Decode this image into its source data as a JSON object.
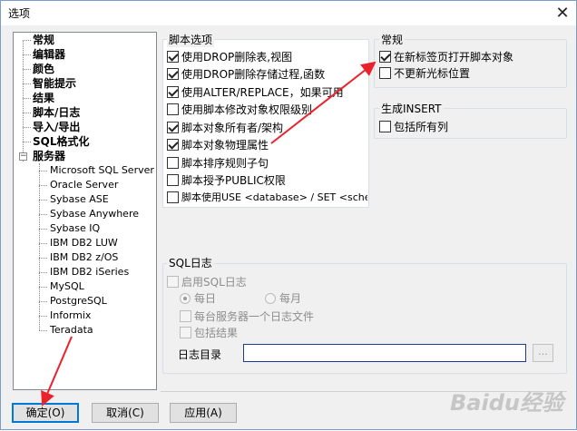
{
  "window": {
    "title": "选项",
    "close_glyph": "✕"
  },
  "tree": {
    "top_items": [
      "常规",
      "编辑器",
      "颜色",
      "智能提示",
      "结果",
      "脚本/日志",
      "导入/导出",
      "SQL格式化"
    ],
    "servers_label": "服务器",
    "servers_expander": "−",
    "server_items": [
      "Microsoft SQL Server",
      "Oracle Server",
      "Sybase ASE",
      "Sybase Anywhere",
      "Sybase IQ",
      "IBM DB2 LUW",
      "IBM DB2 z/OS",
      "IBM DB2 iSeries",
      "MySQL",
      "PostgreSQL",
      "Informix",
      "Teradata"
    ]
  },
  "script_options": {
    "title": "脚本选项",
    "items": [
      {
        "label": "使用DROP删除表,视图",
        "checked": true
      },
      {
        "label": "使用DROP删除存储过程,函数",
        "checked": true
      },
      {
        "label": "使用ALTER/REPLACE，如果可用",
        "checked": true
      },
      {
        "label": "使用脚本修改对象权限级别",
        "checked": false
      },
      {
        "label": "脚本对象所有者/架构",
        "checked": true
      },
      {
        "label": "脚本对象物理属性",
        "checked": true
      },
      {
        "label": "脚本排序规则子句",
        "checked": false
      },
      {
        "label": "脚本授予PUBLIC权限",
        "checked": false
      },
      {
        "label": "脚本使用USE <database> / SET <schem",
        "checked": false
      }
    ]
  },
  "general": {
    "title": "常规",
    "items": [
      {
        "label": "在新标签页打开脚本对象",
        "checked": true
      },
      {
        "label": "不更新光标位置",
        "checked": false
      }
    ]
  },
  "generate_insert": {
    "title": "生成INSERT",
    "items": [
      {
        "label": "包括所有列",
        "checked": false
      }
    ]
  },
  "sql_log": {
    "title": "SQL日志",
    "enable_label": "启用SQL日志",
    "daily_label": "每日",
    "monthly_label": "每月",
    "per_server_label": "每台服务器一个日志文件",
    "include_results_label": "包括结果",
    "log_dir_label": "日志目录",
    "log_dir_value": "",
    "browse_label": "..."
  },
  "buttons": {
    "ok": "确定(O)",
    "cancel": "取消(C)",
    "apply": "应用(A)"
  },
  "watermark": "Baidu经验",
  "colors": {
    "arrow": "#e8232b",
    "accent": "#0078d7"
  }
}
